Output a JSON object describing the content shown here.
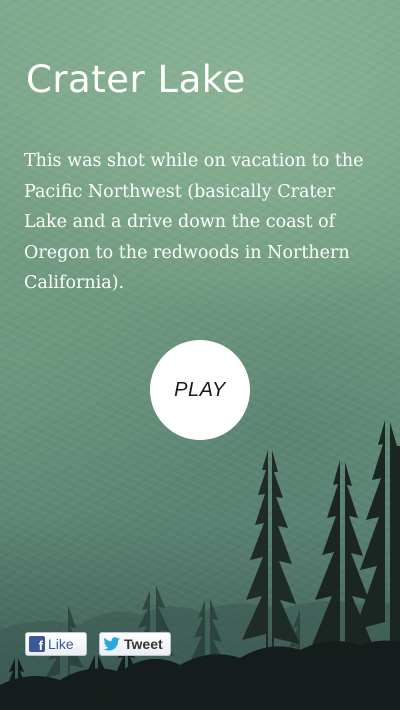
{
  "page": {
    "title": "Crater Lake",
    "description": "This was shot while on vacation to the Pacific Northwest (basically Crater Lake and a drive down the coast of Oregon to the redwoods in Northern California)."
  },
  "play_button": {
    "label": "PLAY"
  },
  "social": {
    "like_label": "Like",
    "tweet_label": "Tweet",
    "facebook_color": "#3b5998",
    "twitter_color": "#2aa9e0"
  },
  "colors": {
    "text": "#ffffff",
    "background_accent": "#6f9a82"
  },
  "icons": [
    "facebook-icon",
    "twitter-bird-icon"
  ]
}
